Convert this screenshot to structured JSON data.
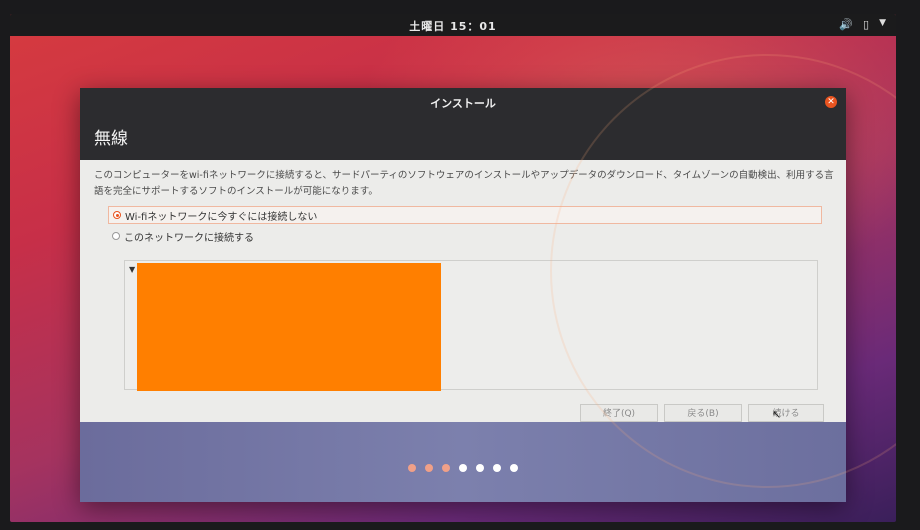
{
  "topbar": {
    "clock": "土曜日 15：01",
    "icons": [
      "volume-icon",
      "battery-icon",
      "system-menu-icon"
    ]
  },
  "window": {
    "title": "インストール",
    "page_title": "無線",
    "description": "このコンピューターをwi-fiネットワークに接続すると、サードパーティのソフトウェアのインストールやアップデータのダウンロード、タイムゾーンの自動検出、利用する言語を完全にサポートするソフトのインストールが可能になります。",
    "options": [
      {
        "label": "Wi-fiネットワークに今すぐには接続しない",
        "selected": true
      },
      {
        "label": "このネットワークに接続する",
        "selected": false
      }
    ],
    "buttons": {
      "quit": "終了(Q)",
      "back": "戻る(B)",
      "continue": "続ける"
    }
  },
  "progress": {
    "total_steps": 7,
    "completed_steps": 3,
    "active_color": "#f0a088",
    "inactive_color": "#ffffff"
  },
  "colors": {
    "accent": "#e95420",
    "redaction": "#ff7f00"
  }
}
